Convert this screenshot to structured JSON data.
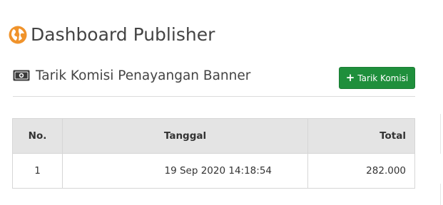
{
  "header": {
    "title": "Dashboard Publisher",
    "icon": "globe-icon",
    "icon_color": "#f0932b"
  },
  "section": {
    "title": "Tarik Komisi Penayangan Banner",
    "icon": "money-icon",
    "button_label": "Tarik Komisi",
    "button_icon": "plus-icon",
    "button_color": "#1f8f3c"
  },
  "table": {
    "columns": [
      "No.",
      "Tanggal",
      "Total"
    ],
    "rows": [
      {
        "no": "1",
        "tanggal": "19 Sep 2020 14:18:54",
        "total": "282.000"
      }
    ]
  }
}
